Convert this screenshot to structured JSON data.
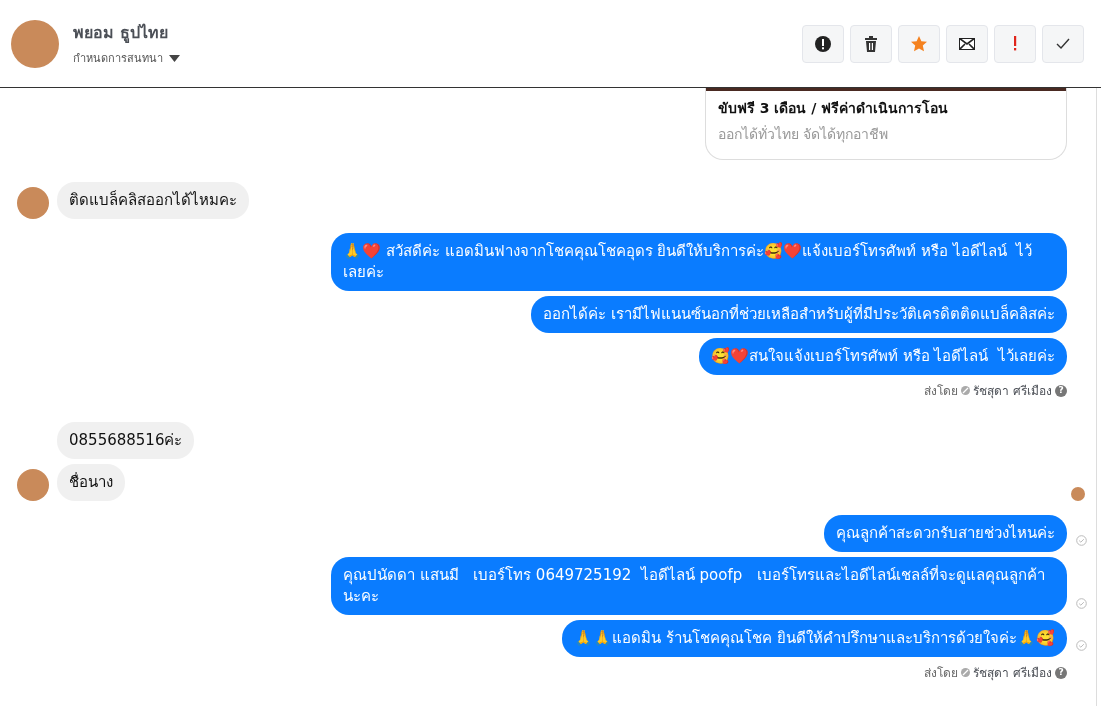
{
  "header": {
    "name": "พยอม ธูปไทย",
    "subtitle": "กำหนดการสนทนา",
    "actions": [
      {
        "kind": "alert"
      },
      {
        "kind": "trash"
      },
      {
        "kind": "star"
      },
      {
        "kind": "mail"
      },
      {
        "kind": "important"
      },
      {
        "kind": "done"
      }
    ]
  },
  "messages": [
    {
      "kind": "card",
      "title": "ขับฟรี 3 เดือน / ฟรีค่าดำเนินการโอน",
      "subtitle": "ออกได้ทั่วไทย จัดได้ทุกอาชีพ"
    },
    {
      "kind": "incoming",
      "bubbles": [
        {
          "text": "ติดแบล็คลิสออกได้ไหมคะ"
        }
      ]
    },
    {
      "kind": "outgoing",
      "bubbles": [
        {
          "text": "🙏❤️ สวัสดีค่ะ แอดมินฟางจากโชคคุณโชคอุดร ยินดีให้บริการค่ะ🥰❤️แจ้งเบอร์โทรศัพท์ หรือ ไอดีไลน์  ไว้เลยค่ะ",
          "delivered": false
        },
        {
          "text": "ออกได้ค่ะ เรามีไฟแนนซ์นอกที่ช่วยเหลือสำหรับผู้ที่มีประวัติเครดิตติดแบล็คลิสค่ะ",
          "delivered": false
        },
        {
          "text": "🥰❤️สนใจแจ้งเบอร์โทรศัพท์ หรือ ไอดีไลน์  ไว้เลยค่ะ",
          "delivered": false
        }
      ]
    },
    {
      "kind": "sent_by",
      "label": "ส่งโดย",
      "agent": "รัชสุดา ศรีเมือง",
      "help": "?"
    },
    {
      "kind": "incoming",
      "bubbles": [
        {
          "text": "0855688516ค่ะ"
        },
        {
          "text": "ชื่อนาง"
        }
      ]
    },
    {
      "kind": "seen"
    },
    {
      "kind": "outgoing",
      "bubbles": [
        {
          "text": "คุณลูกค้าสะดวกรับสายช่วงไหนค่ะ",
          "delivered": true
        },
        {
          "text": "คุณปนัดดา แสนมี   เบอร์โทร 0649725192  ไอดีไลน์ poofp   เบอร์โทรและไอดีไลน์เชลล์ที่จะดูแลคุณลูกค้านะคะ",
          "delivered": true
        },
        {
          "text": "🙏🙏แอดมิน ร้านโชคคุณโชค ยินดีให้คำปรึกษาและบริการด้วยใจค่ะ🙏🥰",
          "delivered": true
        }
      ]
    },
    {
      "kind": "sent_by",
      "label": "ส่งโดย",
      "agent": "รัชสุดา ศรีเมือง",
      "help": "?"
    }
  ]
}
